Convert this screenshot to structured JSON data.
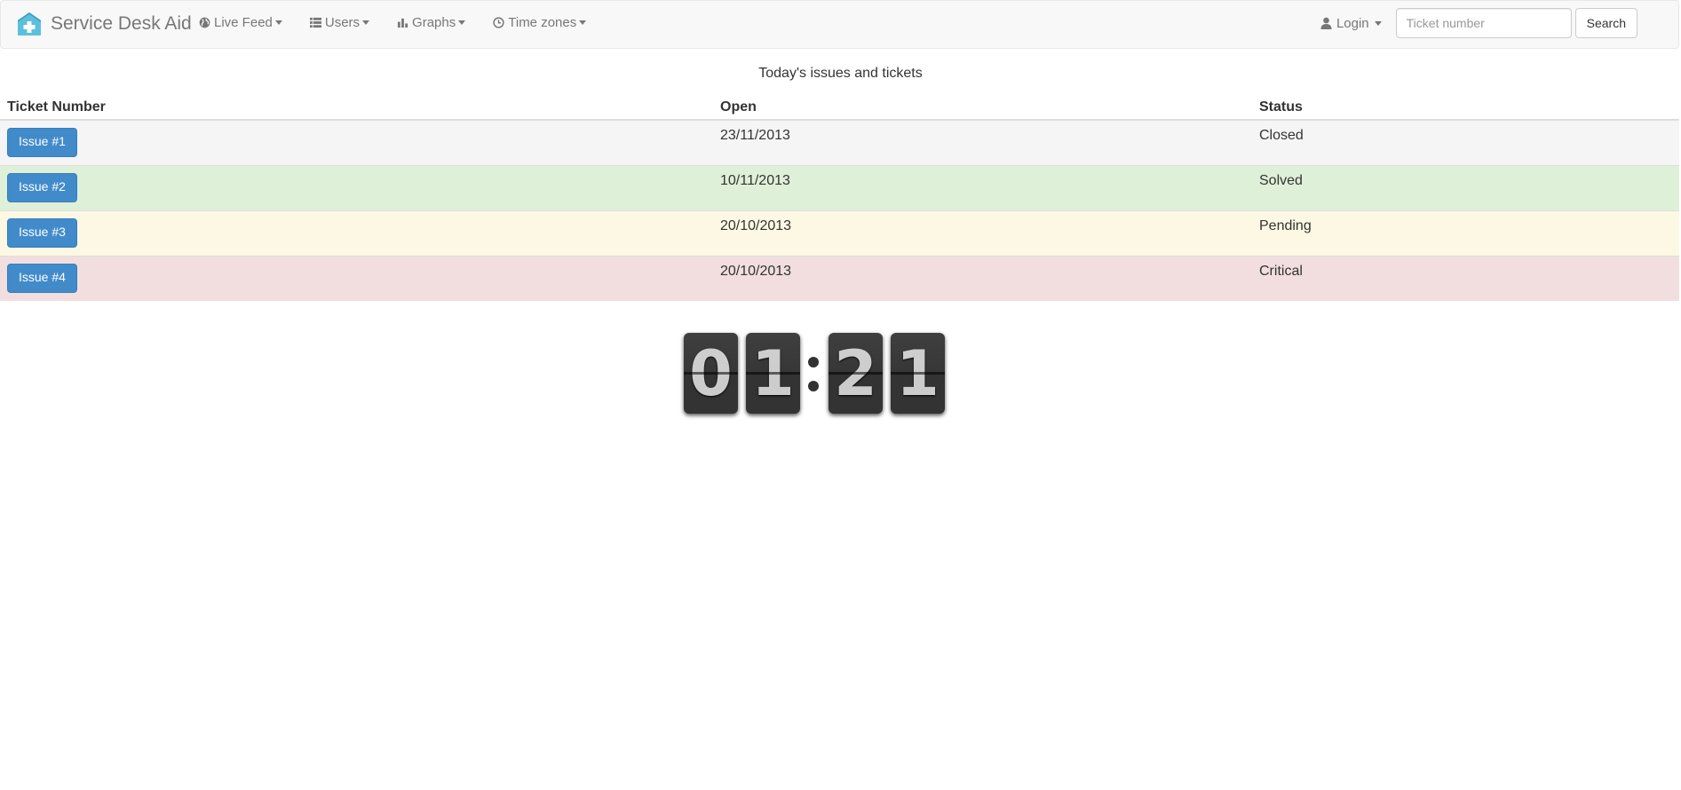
{
  "navbar": {
    "brand": "Service Desk Aid",
    "menu": [
      {
        "label": "Live Feed",
        "icon": "globe-icon"
      },
      {
        "label": "Users",
        "icon": "list-icon"
      },
      {
        "label": "Graphs",
        "icon": "bar-chart-icon"
      },
      {
        "label": "Time zones",
        "icon": "clock-icon"
      }
    ],
    "login_label": "Login",
    "search": {
      "placeholder": "Ticket number",
      "value": "",
      "button": "Search"
    }
  },
  "table": {
    "caption": "Today's issues and tickets",
    "headers": [
      "Ticket Number",
      "Open",
      "Status"
    ],
    "rows": [
      {
        "ticket": "Issue #1",
        "open": "23/11/2013",
        "status": "Closed",
        "color": "#f5f5f5"
      },
      {
        "ticket": "Issue #2",
        "open": "10/11/2013",
        "status": "Solved",
        "color": "#dff0d8"
      },
      {
        "ticket": "Issue #3",
        "open": "20/10/2013",
        "status": "Pending",
        "color": "#fcf8e3"
      },
      {
        "ticket": "Issue #4",
        "open": "20/10/2013",
        "status": "Critical",
        "color": "#f2dede"
      }
    ]
  },
  "clock": {
    "digits": [
      "0",
      "1",
      "2",
      "1"
    ],
    "separator": ":"
  },
  "colors": {
    "primary_button": "#428bca",
    "navbar_bg": "#f8f8f8"
  }
}
